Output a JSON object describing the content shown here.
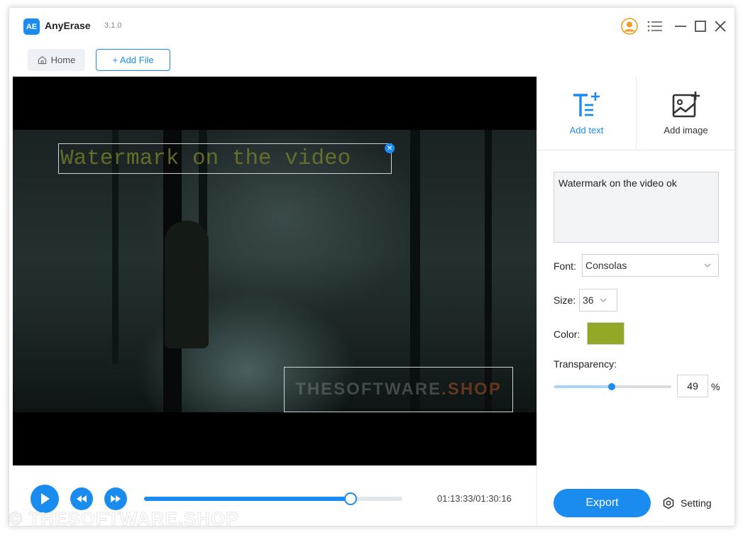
{
  "app": {
    "logo": "AE",
    "name": "AnyErase",
    "version": "3.1.0"
  },
  "window_controls": [
    "user-icon",
    "menu-icon",
    "minimize-icon",
    "maximize-icon",
    "close-icon"
  ],
  "toolbar": {
    "home_label": "Home",
    "add_file_label": "+ Add File"
  },
  "video": {
    "watermark_text": "Watermark on the video",
    "watermark_color": "#6e7a2a",
    "logo_watermark_main": "THESOFTWARE",
    "logo_watermark_tail": ".SHOP"
  },
  "tools": {
    "add_text_label": "Add text",
    "add_image_label": "Add image",
    "active": "add_text"
  },
  "text_settings": {
    "text_value": "Watermark on the video ok",
    "font_label": "Font:",
    "font_value": "Consolas",
    "size_label": "Size:",
    "size_value": "36",
    "color_label": "Color:",
    "color_value": "#93a826",
    "transparency_label": "Transparency:",
    "transparency_value": "49",
    "transparency_unit": "%"
  },
  "player": {
    "progress_fraction": 0.8,
    "current_time": "01:13:33",
    "total_time": "01:30:16",
    "time_display": "01:13:33/01:30:16"
  },
  "actions": {
    "export_label": "Export",
    "setting_label": "Setting"
  },
  "overlay_watermark": "© THESOFTWARE.SHOP",
  "colors": {
    "accent": "#1a8cf0",
    "user_icon": "#f59a23"
  }
}
